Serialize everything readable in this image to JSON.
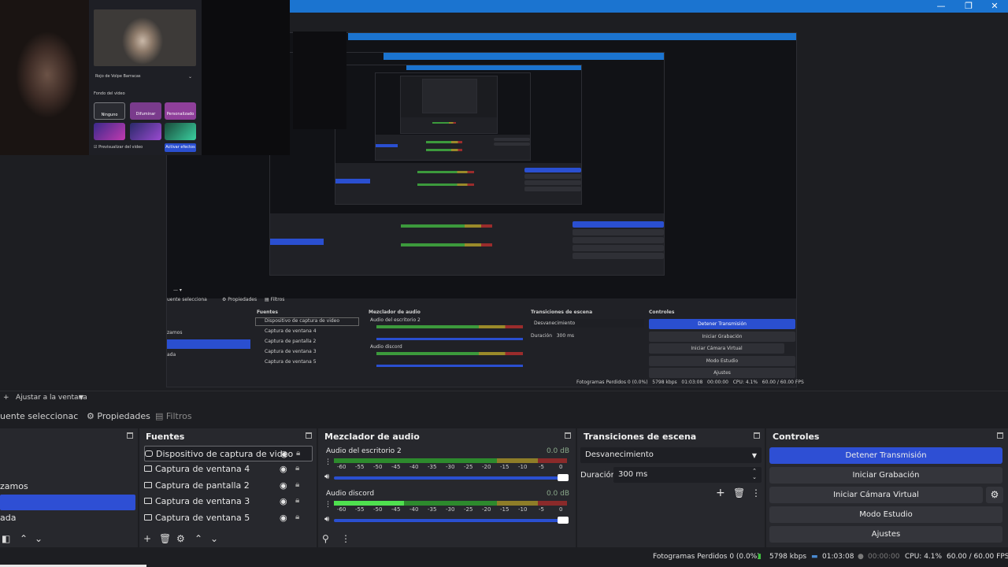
{
  "window": {
    "minimize": "—",
    "restore": "❐",
    "close": "✕"
  },
  "webcam": {
    "channel_label": "Rojo de Volpe Barracas",
    "section_label": "Fondo del video",
    "effects": [
      "Ninguno",
      "Difuminar",
      "Personalizado"
    ],
    "checkbox_label": "Previsualizar del video",
    "apply_button": "Activar efectos"
  },
  "fit_label": "Ajustar a la ventana",
  "toolbar": {
    "selected_source": "uente seleccionac",
    "properties": "Propiedades",
    "filters": "Filtros"
  },
  "scenes": {
    "items": [
      "zamos",
      "",
      "ada"
    ]
  },
  "sources": {
    "title": "Fuentes",
    "items": [
      {
        "label": "Dispositivo de captura de video",
        "icon": "camera-icon"
      },
      {
        "label": "Captura de ventana 4",
        "icon": "window-icon"
      },
      {
        "label": "Captura de pantalla 2",
        "icon": "monitor-icon"
      },
      {
        "label": "Captura de ventana 3",
        "icon": "window-icon"
      },
      {
        "label": "Captura de ventana 5",
        "icon": "window-icon"
      }
    ]
  },
  "mixer": {
    "title": "Mezclador de audio",
    "channels": [
      {
        "name": "Audio del escritorio 2",
        "db": "0.0 dB",
        "level": 0
      },
      {
        "name": "Audio discord",
        "db": "0.0 dB",
        "level": 0.3
      }
    ],
    "scale": [
      "-60",
      "-55",
      "-50",
      "-45",
      "-40",
      "-35",
      "-30",
      "-25",
      "-20",
      "-15",
      "-10",
      "-5",
      "0"
    ]
  },
  "transitions": {
    "title": "Transiciones de escena",
    "selected": "Desvanecimiento",
    "duration_label": "Duración",
    "duration_value": "300 ms"
  },
  "controls": {
    "title": "Controles",
    "stop_stream": "Detener Transmisión",
    "start_recording": "Iniciar Grabación",
    "start_virtual_cam": "Iniciar Cámara Virtual",
    "studio_mode": "Modo Estudio",
    "settings": "Ajustes"
  },
  "status": {
    "dropped_frames": "Fotogramas Perdidos 0 (0.0%)",
    "bitrate": "5798 kbps",
    "stream_time": "01:03:08",
    "record_time": "00:00:00",
    "cpu": "CPU: 4.1%",
    "fps": "60.00 / 60.00 FPS"
  },
  "colors": {
    "accent": "#2e4fd4",
    "titlebar": "#1b74d0",
    "meter_green": "#2d8a2d",
    "meter_yellow": "#8e7d28",
    "meter_red": "#8a2a2a"
  }
}
